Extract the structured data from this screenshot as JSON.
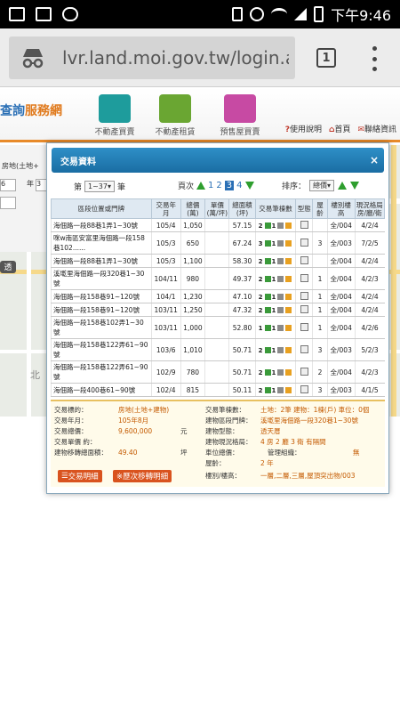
{
  "statusbar": {
    "time": "下午9:46"
  },
  "browser": {
    "url": "lvr.land.moi.gov.tw/login.act",
    "tab_count": "1"
  },
  "site": {
    "logo_part1": "查詢",
    "logo_part2": "服務網",
    "nav": [
      {
        "label": "不動產買賣",
        "color": "#1e9c9c"
      },
      {
        "label": "不動產租賃",
        "color": "#6aa632"
      },
      {
        "label": "預售屋買賣",
        "color": "#c74aa3"
      }
    ],
    "top_links": [
      "使用說明",
      "首頁",
      "聯絡資訊"
    ],
    "side_form": {
      "label": "房地(土地+",
      "year_label": "年",
      "value_6": "6",
      "value_3": "3"
    },
    "map_label": "北",
    "map_badge": "透"
  },
  "modal": {
    "title": "交易資料",
    "close": "×",
    "pager_prefix": "第",
    "pager_select": "1~37",
    "pager_suffix": "筆",
    "page_label": "頁次",
    "pages": [
      "1",
      "2",
      "3",
      "4"
    ],
    "current_page": "3",
    "sort_label": "排序：",
    "sort_select": "總價",
    "headers": [
      "區段位置或門牌",
      "交易年月",
      "總價(萬)",
      "單價(萬/坪)",
      "總面積(坪)",
      "交易筆棟數",
      "型態",
      "屋齡",
      "樓別樓高",
      "現況格局房/廳/衛"
    ],
    "rows": [
      {
        "addr": "海佃路一段88巷1弄1~30號",
        "date": "105/4",
        "price": "1,050",
        "unit": "",
        "area": "57.15",
        "l": "2",
        "b": "1",
        "age": "",
        "floor": "全/004",
        "layout": "4/2/4"
      },
      {
        "addr": "咪w南區安富里海佃路一段158巷102......",
        "date": "105/3",
        "price": "650",
        "unit": "",
        "area": "67.24",
        "l": "3",
        "b": "1",
        "age": "3",
        "floor": "全/003",
        "layout": "7/2/5"
      },
      {
        "addr": "海佃路一段88巷1弄1~30號",
        "date": "105/3",
        "price": "1,100",
        "unit": "",
        "area": "58.30",
        "l": "2",
        "b": "1",
        "age": "",
        "floor": "全/004",
        "layout": "4/2/4"
      },
      {
        "addr": "溪墘里海佃路一段320巷1~30號",
        "date": "104/11",
        "price": "980",
        "unit": "",
        "area": "49.37",
        "l": "2",
        "b": "1",
        "age": "1",
        "floor": "全/004",
        "layout": "4/2/3"
      },
      {
        "addr": "海佃路一段158巷91~120號",
        "date": "104/1",
        "price": "1,230",
        "unit": "",
        "area": "47.10",
        "l": "2",
        "b": "1",
        "age": "1",
        "floor": "全/004",
        "layout": "4/2/4"
      },
      {
        "addr": "海佃路一段158巷91~120號",
        "date": "103/11",
        "price": "1,250",
        "unit": "",
        "area": "47.32",
        "l": "2",
        "b": "1",
        "age": "1",
        "floor": "全/004",
        "layout": "4/2/4"
      },
      {
        "addr": "海佃路一段158巷102弄1~30號",
        "date": "103/11",
        "price": "1,000",
        "unit": "",
        "area": "52.80",
        "l": "1",
        "b": "1",
        "age": "1",
        "floor": "全/004",
        "layout": "4/2/6"
      },
      {
        "addr": "海佃路一段158巷122弄61~90號",
        "date": "103/6",
        "price": "1,010",
        "unit": "",
        "area": "50.71",
        "l": "2",
        "b": "1",
        "age": "3",
        "floor": "全/003",
        "layout": "5/2/3"
      },
      {
        "addr": "海佃路一段158巷122弄61~90號",
        "date": "102/9",
        "price": "780",
        "unit": "",
        "area": "50.71",
        "l": "2",
        "b": "1",
        "age": "2",
        "floor": "全/004",
        "layout": "4/2/3"
      },
      {
        "addr": "海佃路一段400巷61~90號",
        "date": "102/4",
        "price": "815",
        "unit": "",
        "area": "50.11",
        "l": "2",
        "b": "1",
        "age": "3",
        "floor": "全/003",
        "layout": "4/1/5"
      }
    ],
    "detail": {
      "target_label": "交易標的：",
      "target_value": "房地(土地+建物)",
      "date_label": "交易年月：",
      "date_value": "105年8月",
      "price_label": "交易總價：",
      "price_value": "9,600,000",
      "price_unit": "元",
      "unit_label": "交易單價 約：",
      "area_label": "建物移轉總面積：",
      "area_value": "49.40",
      "area_unit": "坪",
      "count_label": "交易筆棟數：",
      "count_value": "土地：2筆 建物：1棟(戶) 車位：0個",
      "addr_label": "建物區段門牌：",
      "addr_value": "溪墘里海佃路一段320巷1~30號",
      "type_label": "建物型態：",
      "type_value": "透天厝",
      "layout_label": "建物現況格局：",
      "layout_value": "4 房 2 廳 3 衛 有隔間",
      "parking_label": "車位總價：",
      "mgmt_label": "管理組織：",
      "mgmt_value": "無",
      "age_label": "屋齡：",
      "age_value": "2 年",
      "floor_label": "樓別/樓高：",
      "floor_value": "一層,二層,三層,屋頂突出物/003",
      "btn1": "交易明細",
      "btn2": "※歷次移轉明細"
    }
  }
}
